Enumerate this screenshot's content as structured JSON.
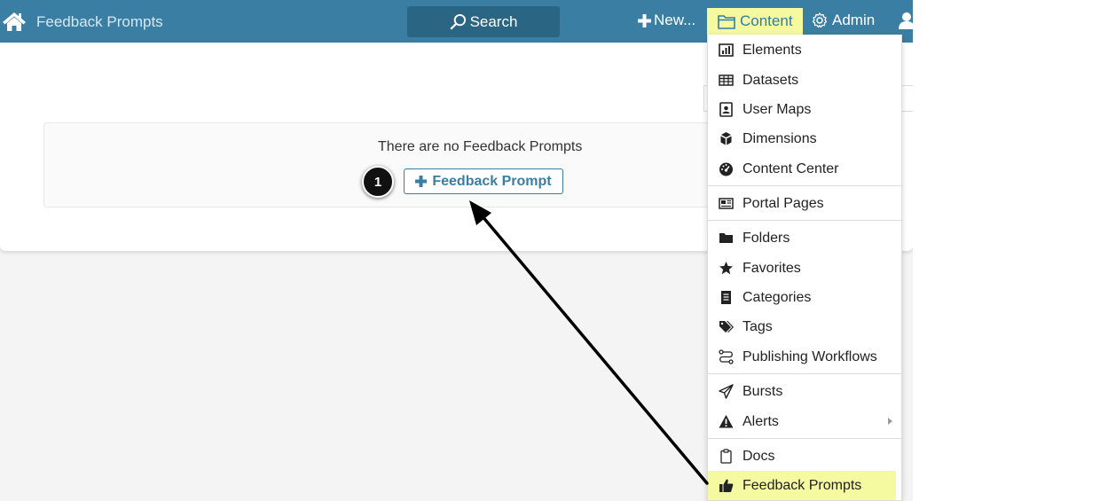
{
  "header": {
    "title": "Feedback Prompts",
    "search_label": "Search",
    "new_label": "New...",
    "content_label": "Content",
    "admin_label": "Admin"
  },
  "main": {
    "empty_message": "There are no Feedback Prompts",
    "add_button_label": "Feedback Prompt",
    "step_number": "1"
  },
  "content_menu": {
    "items": [
      {
        "label": "Elements",
        "icon": "bar-chart-icon"
      },
      {
        "label": "Datasets",
        "icon": "table-icon"
      },
      {
        "label": "User Maps",
        "icon": "contact-card-icon"
      },
      {
        "label": "Dimensions",
        "icon": "cubes-icon"
      },
      {
        "label": "Content Center",
        "icon": "dashboard-icon"
      },
      {
        "label": "Portal Pages",
        "icon": "newspaper-icon"
      },
      {
        "label": "Folders",
        "icon": "folder-icon"
      },
      {
        "label": "Favorites",
        "icon": "star-icon"
      },
      {
        "label": "Categories",
        "icon": "book-icon"
      },
      {
        "label": "Tags",
        "icon": "tags-icon"
      },
      {
        "label": "Publishing Workflows",
        "icon": "workflow-icon"
      },
      {
        "label": "Bursts",
        "icon": "paper-plane-icon"
      },
      {
        "label": "Alerts",
        "icon": "warning-icon"
      },
      {
        "label": "Docs",
        "icon": "clipboard-icon"
      },
      {
        "label": "Feedback Prompts",
        "icon": "thumbs-up-icon"
      }
    ]
  },
  "colors": {
    "topbar": "#3a7fa3",
    "highlight": "#f5f9a0",
    "accent": "#3a7fa3"
  }
}
